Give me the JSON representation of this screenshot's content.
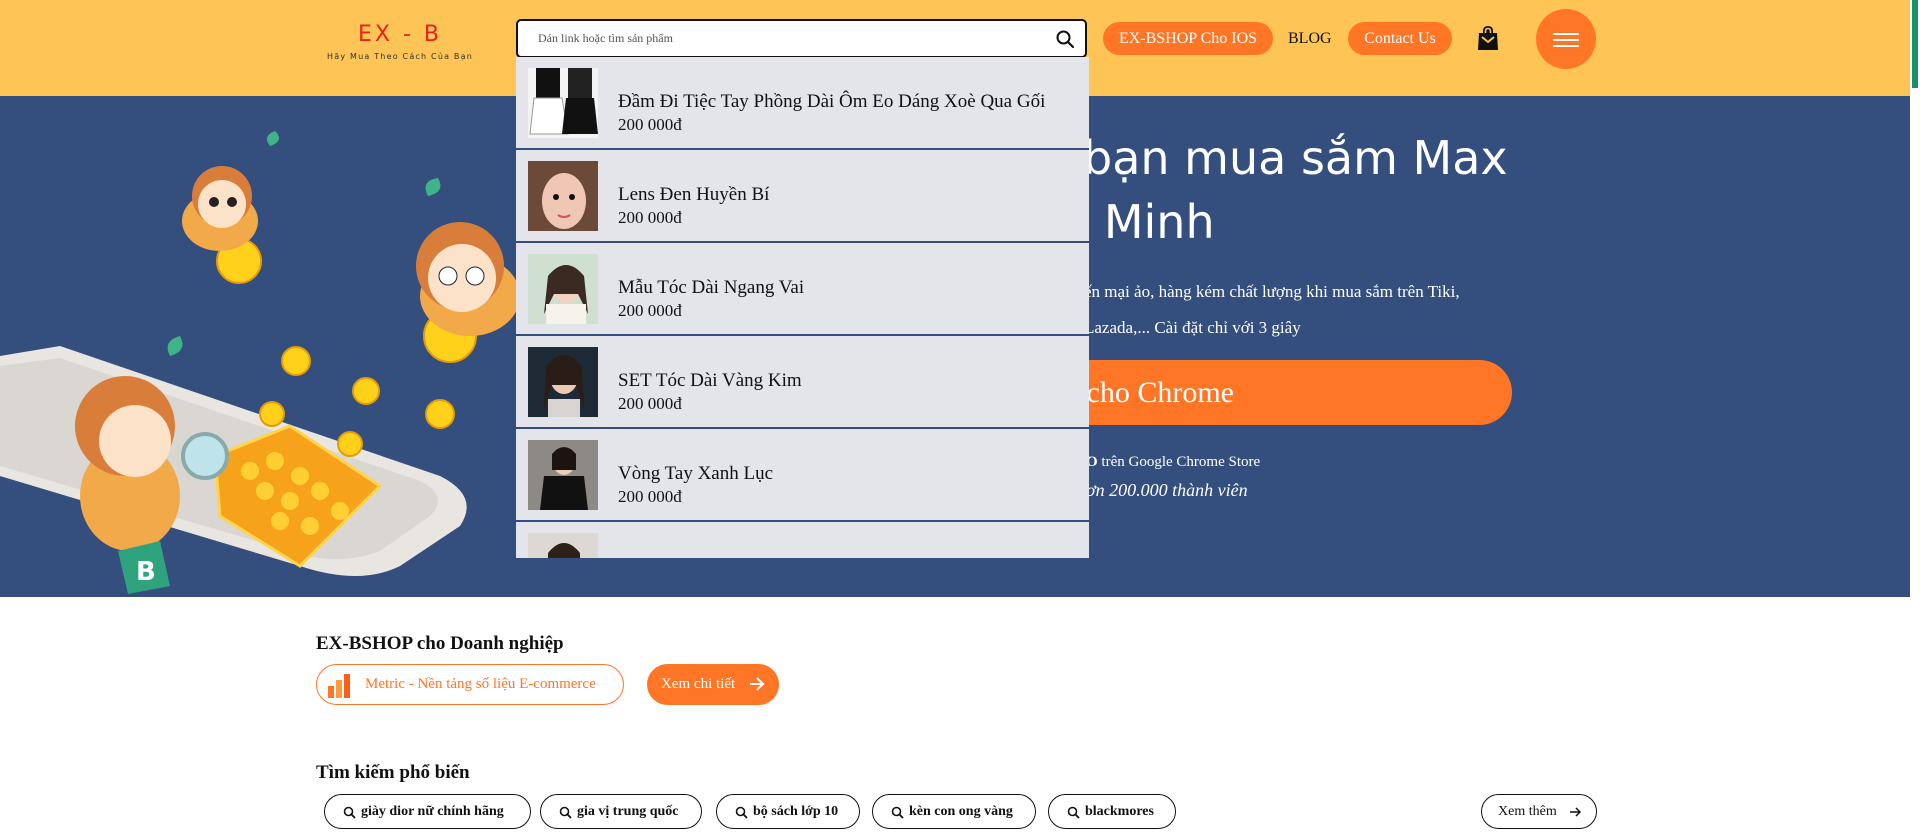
{
  "colors": {
    "accent": "#ff7626",
    "header_bg": "#fec455",
    "hero_bg": "#344f7d",
    "dropdown_bg": "#e3e5ea",
    "logo_red": "#e8231d"
  },
  "header": {
    "logo_title": "EX - B",
    "logo_tagline": "Hãy Mua Theo Cách Của Bạn",
    "search_placeholder": "Dán link hoặc tìm sản phẩm",
    "search_value": "",
    "nav_ios": "EX-BSHOP Cho IOS",
    "nav_blog": "BLOG",
    "nav_contact": "Contact Us",
    "icons": [
      "search-icon",
      "shopping-bag-icon",
      "hamburger-menu-icon"
    ]
  },
  "hero": {
    "title_line1": "bạn mua sắm Max",
    "title_line2": "g Minh",
    "desc_line1": "ến mại ảo, hàng kém chất lượng khi mua sắm trên Tiki,",
    "desc_line2": "Lazada,... Cài đặt chỉ với 3 giây",
    "cta": "g cho Chrome",
    "store_prefix": "O",
    "store_text": "trên Google Chrome Store",
    "members": "ơn 200.000 thành viên"
  },
  "dropdown": {
    "suggestions": [
      {
        "name": "Đầm Đi Tiệc Tay Phồng Dài Ôm Eo Dáng Xoè Qua Gối",
        "price": "200 000đ",
        "thumb": "skirt-photo"
      },
      {
        "name": "Lens Đen Huyền Bí",
        "price": "200 000đ",
        "thumb": "portrait-photo"
      },
      {
        "name": "Mẫu Tóc Dài Ngang Vai",
        "price": "200 000đ",
        "thumb": "hair-photo"
      },
      {
        "name": "SET Tóc Dài Vàng Kim",
        "price": "200 000đ",
        "thumb": "hair-photo"
      },
      {
        "name": "Vòng Tay Xanh Lục",
        "price": "200 000đ",
        "thumb": "bracelet-photo"
      },
      {
        "name": "",
        "price": "",
        "thumb": "portrait-photo"
      }
    ]
  },
  "enterprise": {
    "title": "EX-BSHOP cho Doanh nghiệp",
    "metric_label": "Metric - Nền tảng số liệu E-commerce",
    "detail_button": "Xem chi tiết"
  },
  "popular": {
    "title": "Tìm kiếm phổ biến",
    "tags": [
      "giày dior nữ chính hãng",
      "gia vị trung quốc",
      "bộ sách lớp 10",
      "kèn con ong vàng",
      "blackmores"
    ],
    "see_more": "Xem thêm"
  }
}
